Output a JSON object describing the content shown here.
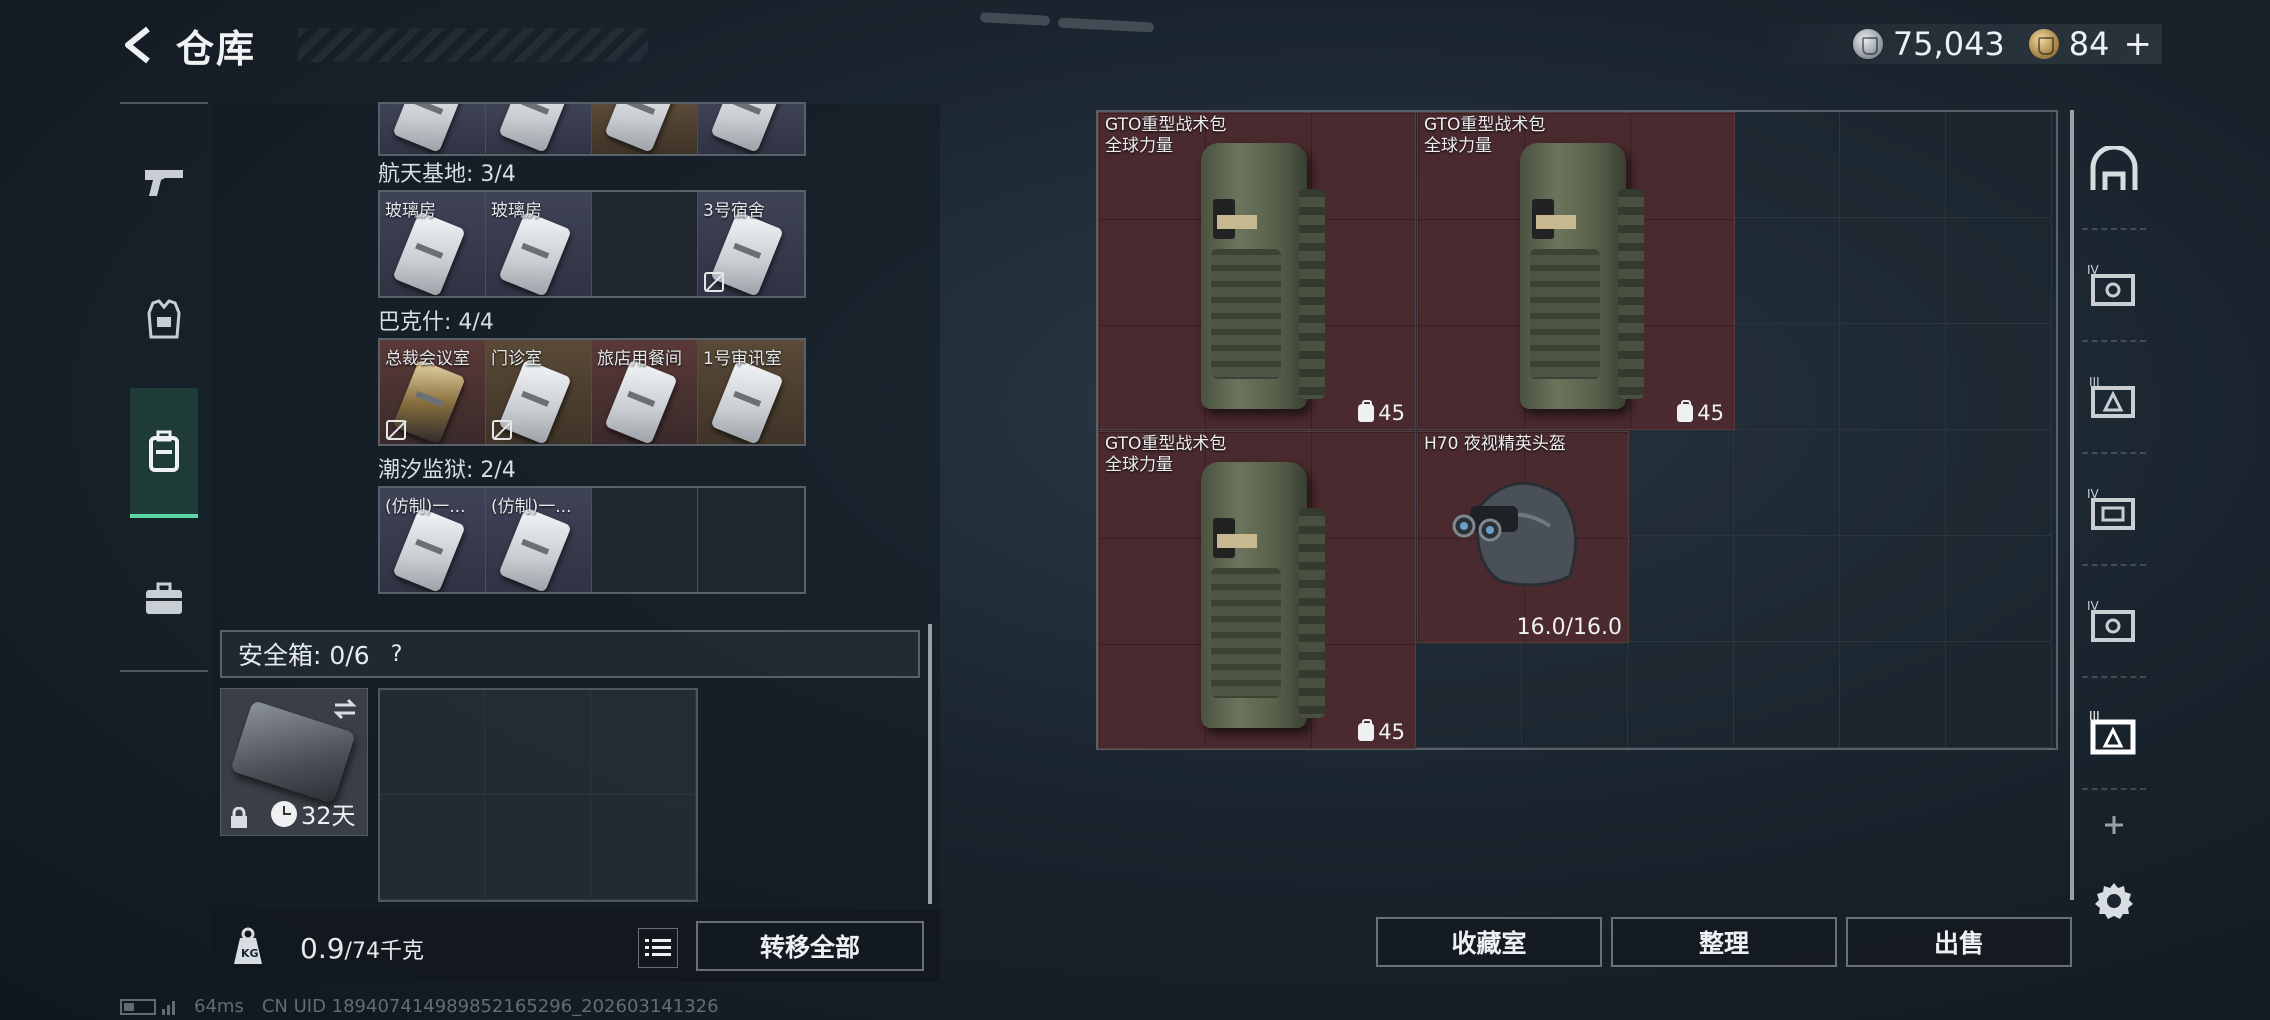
{
  "header": {
    "title": "仓库"
  },
  "currency": {
    "silver": "75,043",
    "gold": "84",
    "plus": "+"
  },
  "left_nav": [
    {
      "id": "weapons",
      "icon": "gun-icon"
    },
    {
      "id": "gear",
      "icon": "vest-icon"
    },
    {
      "id": "backpack",
      "icon": "backpack-icon",
      "active": true
    },
    {
      "id": "case",
      "icon": "briefcase-icon"
    }
  ],
  "keycards": {
    "groups": [
      {
        "label": "航天基地: 3/4",
        "cells": [
          {
            "name": "玻璃房",
            "rarity": "purple",
            "no_trade": false
          },
          {
            "name": "玻璃房",
            "rarity": "purple",
            "no_trade": false
          },
          {
            "name": "",
            "rarity": "empty",
            "no_trade": false
          },
          {
            "name": "3号宿舍",
            "rarity": "purple",
            "no_trade": true
          }
        ]
      },
      {
        "label": "巴克什: 4/4",
        "cells": [
          {
            "name": "总裁会议室",
            "rarity": "red",
            "no_trade": true
          },
          {
            "name": "门诊室",
            "rarity": "gold",
            "no_trade": true
          },
          {
            "name": "旅店用餐间",
            "rarity": "red",
            "no_trade": false
          },
          {
            "name": "1号审讯室",
            "rarity": "gold",
            "no_trade": false
          }
        ]
      },
      {
        "label": "潮汐监狱: 2/4",
        "cells": [
          {
            "name": "(仿制)一...",
            "rarity": "purple",
            "no_trade": false
          },
          {
            "name": "(仿制)一...",
            "rarity": "purple",
            "no_trade": false
          },
          {
            "name": "",
            "rarity": "empty",
            "no_trade": false
          },
          {
            "name": "",
            "rarity": "empty",
            "no_trade": false
          }
        ]
      }
    ]
  },
  "safe": {
    "label": "安全箱: 0/6",
    "help": "?",
    "days": "32天"
  },
  "footer": {
    "weight": "0.9",
    "weight_max": "/74千克",
    "transfer_all": "转移全部"
  },
  "storage": {
    "items": [
      {
        "name": "GTO重型战术包",
        "sub": "全球力量",
        "value": "45",
        "kind": "backpack"
      },
      {
        "name": "GTO重型战术包",
        "sub": "全球力量",
        "value": "45",
        "kind": "backpack"
      },
      {
        "name": "GTO重型战术包",
        "sub": "全球力量",
        "value": "45",
        "kind": "backpack"
      },
      {
        "name": "H70 夜视精英头盔",
        "sub": "",
        "value": "16.0/16.0",
        "kind": "helmet"
      }
    ]
  },
  "actions": {
    "collection": "收藏室",
    "sort": "整理",
    "sell": "出售"
  },
  "right_nav": [
    {
      "icon": "gate-icon",
      "badge": ""
    },
    {
      "icon": "storage-tier-icon",
      "badge": "IV"
    },
    {
      "icon": "storage-tier-icon",
      "badge": "III"
    },
    {
      "icon": "storage-tier-icon",
      "badge": "IV"
    },
    {
      "icon": "storage-tier-icon",
      "badge": "IV"
    },
    {
      "icon": "storage-tier-icon",
      "badge": "III"
    },
    {
      "icon": "plus-icon",
      "badge": ""
    }
  ],
  "status": {
    "ping": "64ms",
    "uid": "CN UID 1894074149898521652​96_202603141326"
  }
}
